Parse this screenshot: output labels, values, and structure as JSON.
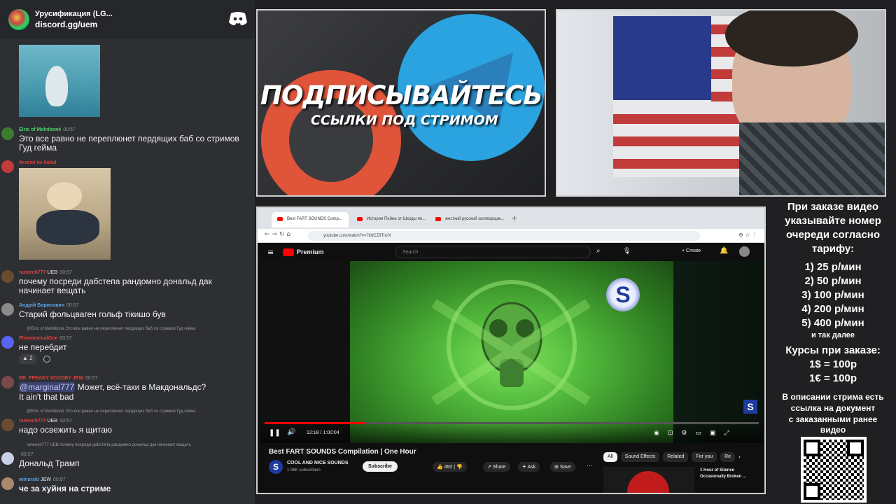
{
  "discord": {
    "server_name": "Урусификация (LG...",
    "invite": "discord.gg/uem",
    "messages": [
      {
        "name": "Elric of Melniboné",
        "time": "00:57",
        "name_color": "#4bd66b",
        "text": "Это все равно не переплюнет пердящих баб со стримов Гуд гейма"
      },
      {
        "name": "Arsenii ne kakal",
        "time": "",
        "name_color": "#e0413d",
        "text": ""
      },
      {
        "name": "raneech777",
        "badge": "UEB",
        "time": "00:57",
        "name_color": "#e0413d",
        "text": "почему посреди дабстепа рандомно дональд дак начинает вещать"
      },
      {
        "name": "Андрій Борисович",
        "time": "00:57",
        "name_color": "#5aa5e8",
        "text": "Старий фольцваген гольф тікишо був"
      },
      {
        "reply": "@Elric of Melniboné Это все равно не переплюнет пердящих баб со стримов Гуд гейма",
        "name": "PhenomenalOne",
        "time": "00:57",
        "name_color": "#e0413d",
        "text": "не перебдит",
        "reaction_count": "2"
      },
      {
        "name": "DR. FREAKY SCOOBY JEW",
        "time": "00:57",
        "name_color": "#e0413d",
        "mention": "@marginal777",
        "text": " Может, всё-таки в Макдональдс?",
        "text2": "It ain't that bad"
      },
      {
        "reply": "@Elric of Melniboné Это все равно не переплюнет пердящих баб со стримов Гуд гейма",
        "name": "raneech777",
        "badge": "UEB",
        "time": "00:57",
        "name_color": "#e0413d",
        "text": "надо освежить я щитаю"
      },
      {
        "reply": "raneech777 UEB почему посреди дабстепа рандомно дональд дак начинает вещать",
        "time": "00:57",
        "text": "Дональд Трамп"
      },
      {
        "name": "minarski",
        "badge": "JEW",
        "time": "00:57",
        "name_color": "#5aa5e8",
        "text": "че за хуйня на стриме"
      }
    ]
  },
  "promo": {
    "headline": "ПОДПИСЫВАЙТЕСЬ",
    "subline": "ССЫЛКИ ПОД СТРИМОМ"
  },
  "browser": {
    "tabs": [
      "Best FART SOUNDS Comp...",
      "История Пейна от Шкоды по...",
      "жесткий русский заговорщик..."
    ],
    "url": "youtube.com/watch?v=7k8CZ8Tru0I"
  },
  "youtube": {
    "brand": "Premium",
    "search_placeholder": "Search",
    "create_label": "Create",
    "time": "12:18 / 1:00:04",
    "progress": 0.205,
    "title": "Best FART SOUNDS Compilation | One Hour",
    "channel": "COOL AND NICE SOUNDS",
    "subscribers": "1.96K subscribers",
    "subscribe": "Subscribe",
    "likes": "492",
    "share": "Share",
    "ask": "Ask",
    "save": "Save",
    "chips": [
      "All",
      "Sound Effects",
      "Related",
      "For you",
      "Re"
    ],
    "rec_title": "1 Hour of Silence Occasionally Broken ..."
  },
  "side": {
    "intro": [
      "При заказе видео",
      "указывайте номер",
      "очереди согласно",
      "тарифу:"
    ],
    "rates": [
      "1) 25 р/мин",
      "2) 50 р/мин",
      "3) 100 р/мин",
      "4) 200 р/мин",
      "5) 400 р/мин"
    ],
    "etc": "и так далее",
    "fx_title": "Курсы при заказе:",
    "fx": [
      "1$ = 100р",
      "1€ = 100р"
    ],
    "note": [
      "В описании стрима есть",
      "ссылка на документ",
      "с заказанными ранее",
      "видео"
    ]
  }
}
